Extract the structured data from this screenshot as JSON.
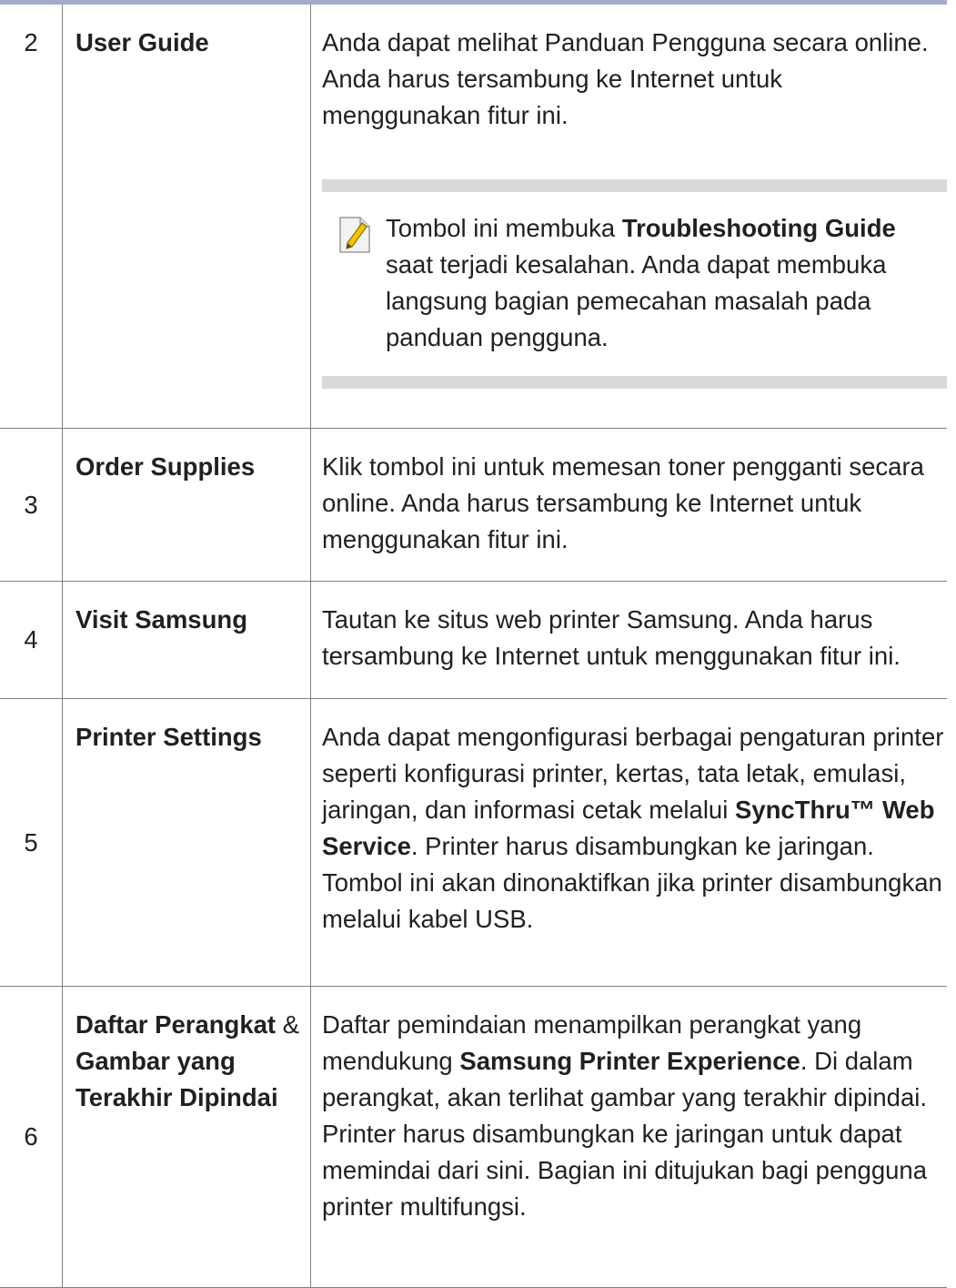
{
  "rows": [
    {
      "number": "2",
      "feature": "User Guide",
      "description": "Anda dapat melihat Panduan Pengguna secara online. Anda harus tersambung ke Internet untuk menggunakan fitur ini.",
      "note": {
        "icon": "note-pencil-icon",
        "text_1": "Tombol ini membuka ",
        "bold_1": "Troubleshooting Guide",
        "text_2": " saat terjadi kesalahan. Anda dapat membuka langsung bagian pemecahan masalah pada panduan pengguna."
      }
    },
    {
      "number": "3",
      "feature": "Order Supplies",
      "description": "Klik tombol ini untuk memesan toner pengganti secara online. Anda harus tersambung ke Internet untuk menggunakan fitur ini."
    },
    {
      "number": "4",
      "feature": "Visit Samsung",
      "description": "Tautan ke situs web printer Samsung. Anda harus tersambung ke Internet untuk menggunakan fitur ini."
    },
    {
      "number": "5",
      "feature": "Printer Settings",
      "description_1": "Anda dapat mengonfigurasi berbagai pengaturan printer seperti konfigurasi printer, kertas, tata letak, emulasi, jaringan, dan informasi cetak melalui ",
      "description_bold": "SyncThru™ Web Service",
      "description_2": ". Printer harus disambungkan ke jaringan. Tombol ini akan dinonaktifkan jika printer disambungkan melalui kabel USB."
    },
    {
      "number": "6",
      "feature_1": "Daftar Perangkat",
      "feature_sep": " & ",
      "feature_2": "Gambar yang Terakhir Dipindai",
      "description_1": "Daftar pemindaian menampilkan perangkat yang mendukung ",
      "description_bold": "Samsung Printer Experience",
      "description_2": ". Di dalam perangkat, akan terlihat gambar yang terakhir dipindai. Printer harus disambungkan ke jaringan untuk dapat memindai dari sini. Bagian ini ditujukan bagi pengguna printer multifungsi."
    }
  ],
  "colors": {
    "rule": "#a7a9c8",
    "note_band": "#d9d9d9",
    "grid": "#808080"
  }
}
